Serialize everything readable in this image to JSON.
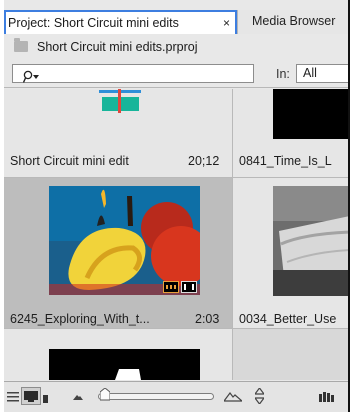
{
  "tabs": {
    "project": "Project: Short Circuit mini edits",
    "project_close": "×",
    "media_browser": "Media Browser"
  },
  "project_file": "Short Circuit mini edits.prproj",
  "search": {
    "icon": "search-icon",
    "dropdown_arrow": "▾",
    "in_label": "In:",
    "in_value": "All"
  },
  "items": [
    {
      "name": "Short Circuit mini edit",
      "duration": "20;12",
      "type": "sequence"
    },
    {
      "name": "0841_Time_Is_L",
      "duration": "",
      "type": "clip"
    },
    {
      "name": "6245_Exploring_With_t...",
      "duration": "2:03",
      "type": "clip",
      "selected": true
    },
    {
      "name": "0034_Better_Use",
      "duration": "",
      "type": "clip"
    }
  ],
  "colors": {
    "tab_highlight": "#3d7ee0",
    "selected_cell": "#bdbdbd",
    "panel_bg": "#e8e8e8"
  },
  "toolbar": {
    "list_view": "list-view-icon",
    "icon_view": "icon-view-icon",
    "zoom_small": "mountain-small-icon",
    "zoom_slider_value": 0.05,
    "zoom_large": "mountain-large-icon",
    "sort": "sort-icon",
    "automate": "automate-to-sequence-icon"
  }
}
